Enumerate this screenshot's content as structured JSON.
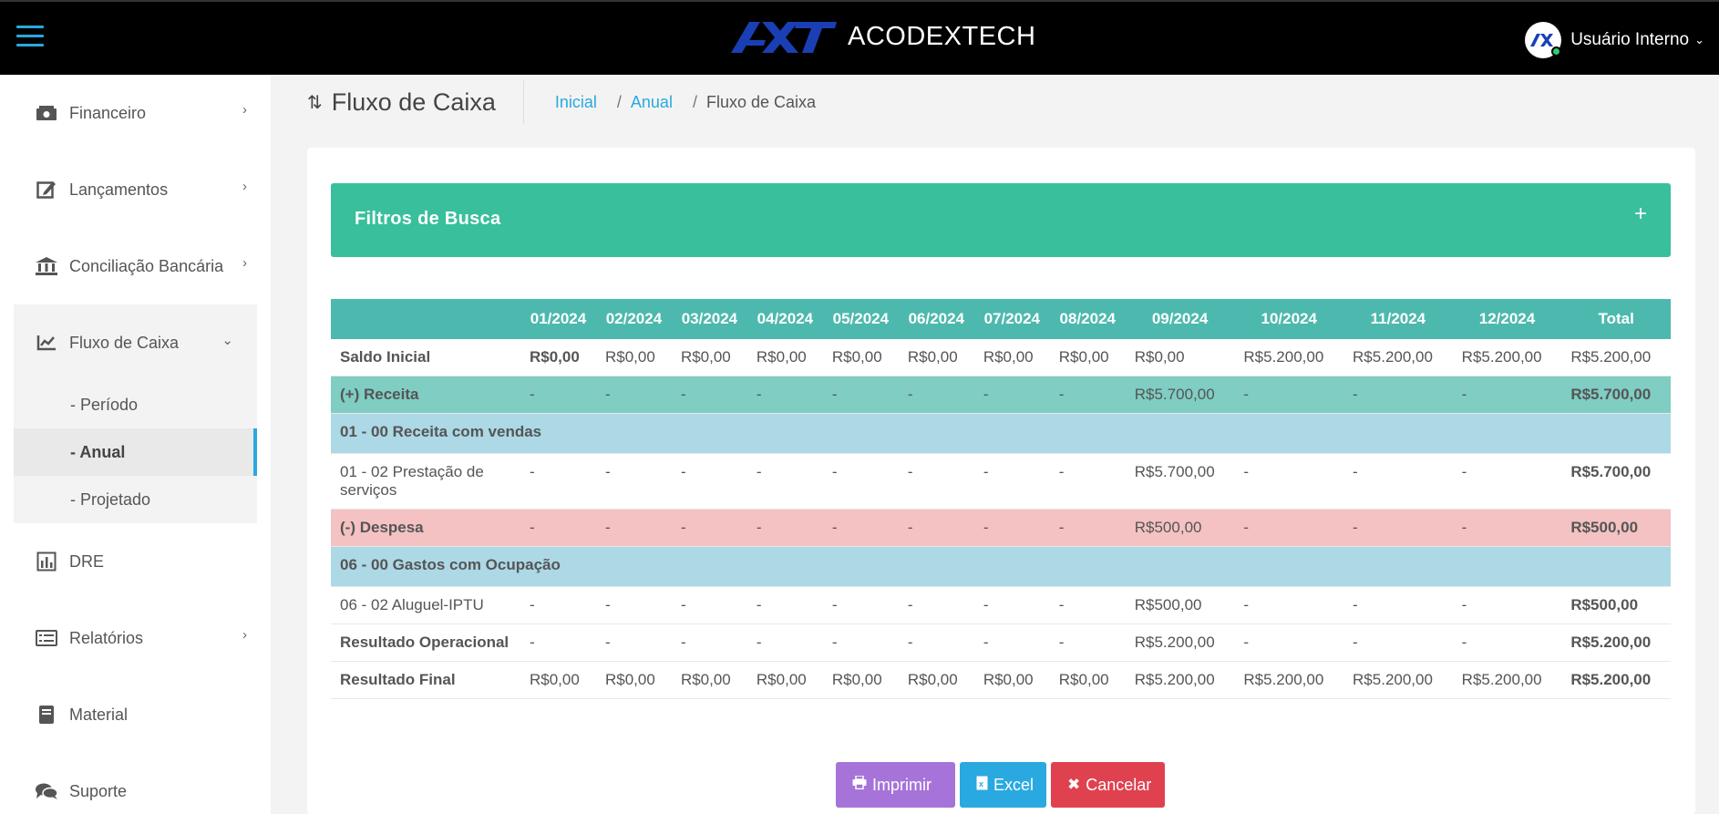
{
  "header": {
    "brand_name": "ACODEXTECH",
    "user_name": "Usuário Interno",
    "user_caret": "⌄",
    "accent": "#29a9e0"
  },
  "sidebar": {
    "items": [
      {
        "label": "Financeiro",
        "icon": "money-icon"
      },
      {
        "label": "Lançamentos",
        "icon": "edit-icon"
      },
      {
        "label": "Conciliação Bancária",
        "icon": "bank-icon"
      },
      {
        "label": "Fluxo de Caixa",
        "icon": "line-chart-icon"
      },
      {
        "label": "DRE",
        "icon": "bar-chart-icon"
      },
      {
        "label": "Relatórios",
        "icon": "list-icon"
      },
      {
        "label": "Material",
        "icon": "book-icon"
      },
      {
        "label": "Suporte",
        "icon": "comments-icon"
      }
    ],
    "subitems": [
      "- Período",
      "- Anual",
      "- Projetado"
    ]
  },
  "page": {
    "title": "Fluxo de Caixa",
    "breadcrumb": [
      "Inicial",
      "Anual",
      "Fluxo de Caixa"
    ]
  },
  "filters": {
    "title": "Filtros de Busca",
    "toggle": "+"
  },
  "table": {
    "headers": [
      "",
      "01/2024",
      "02/2024",
      "03/2024",
      "04/2024",
      "05/2024",
      "06/2024",
      "07/2024",
      "08/2024",
      "09/2024",
      "10/2024",
      "11/2024",
      "12/2024",
      "Total"
    ],
    "rows": [
      {
        "type": "normal",
        "cells": [
          "Saldo Inicial",
          "R$0,00",
          "R$0,00",
          "R$0,00",
          "R$0,00",
          "R$0,00",
          "R$0,00",
          "R$0,00",
          "R$0,00",
          "R$0,00",
          "R$5.200,00",
          "R$5.200,00",
          "R$5.200,00",
          "R$5.200,00"
        ]
      },
      {
        "type": "rec",
        "cells": [
          "(+) Receita",
          "-",
          "-",
          "-",
          "-",
          "-",
          "-",
          "-",
          "-",
          "R$5.700,00",
          "-",
          "-",
          "-",
          "R$5.700,00"
        ]
      },
      {
        "type": "cat",
        "cells": [
          "01 - 00 Receita com vendas"
        ]
      },
      {
        "type": "normal",
        "cells": [
          "01 - 02 Prestação de serviços",
          "-",
          "-",
          "-",
          "-",
          "-",
          "-",
          "-",
          "-",
          "R$5.700,00",
          "-",
          "-",
          "-",
          "R$5.700,00"
        ]
      },
      {
        "type": "desp",
        "cells": [
          "(-) Despesa",
          "-",
          "-",
          "-",
          "-",
          "-",
          "-",
          "-",
          "-",
          "R$500,00",
          "-",
          "-",
          "-",
          "R$500,00"
        ]
      },
      {
        "type": "cat",
        "cells": [
          "06 - 00 Gastos com Ocupação"
        ]
      },
      {
        "type": "normal",
        "cells": [
          "06 - 02 Aluguel-IPTU",
          "-",
          "-",
          "-",
          "-",
          "-",
          "-",
          "-",
          "-",
          "R$500,00",
          "-",
          "-",
          "-",
          "R$500,00"
        ]
      },
      {
        "type": "normal",
        "cells": [
          "Resultado Operacional",
          "-",
          "-",
          "-",
          "-",
          "-",
          "-",
          "-",
          "-",
          "R$5.200,00",
          "-",
          "-",
          "-",
          "R$5.200,00"
        ]
      },
      {
        "type": "normal",
        "cells": [
          "Resultado Final",
          "R$0,00",
          "R$0,00",
          "R$0,00",
          "R$0,00",
          "R$0,00",
          "R$0,00",
          "R$0,00",
          "R$0,00",
          "R$5.200,00",
          "R$5.200,00",
          "R$5.200,00",
          "R$5.200,00",
          "R$5.200,00"
        ]
      }
    ]
  },
  "buttons": {
    "print": "Imprimir",
    "excel": "Excel",
    "cancel": "Cancelar"
  },
  "colors": {
    "filter_bar": "#39bf9c",
    "table_header": "#4db9ae",
    "receita_row": "#7fcdc3",
    "category_row": "#add8e6",
    "despesa_row": "#f4c2c2",
    "print_button": "#a674d8",
    "excel_button": "#29a9e0",
    "cancel_button": "#e0414f"
  }
}
